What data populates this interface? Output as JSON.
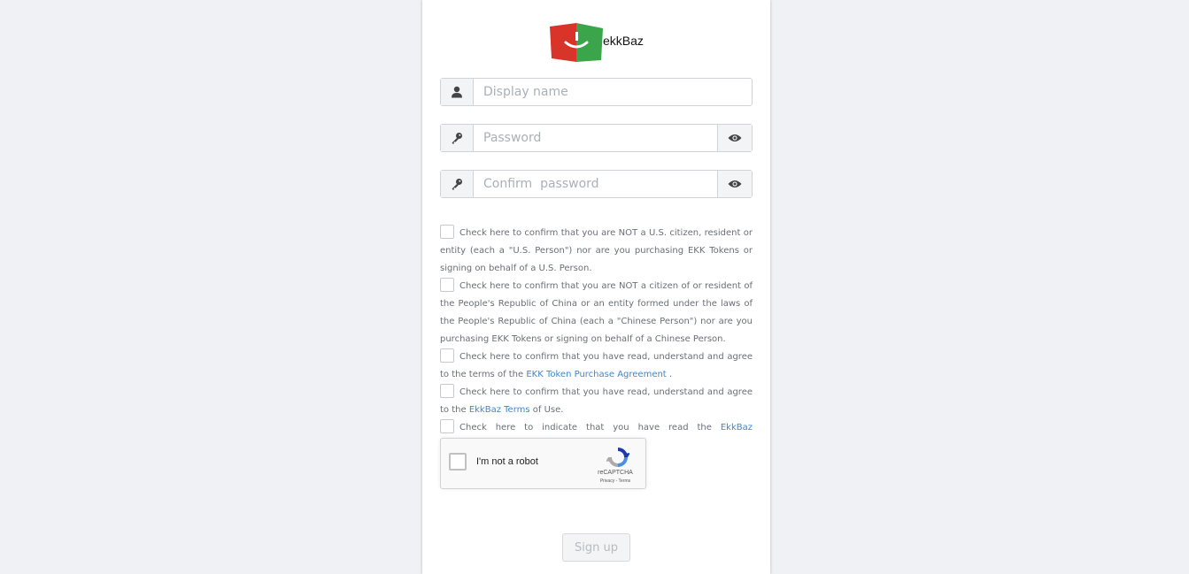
{
  "brand": {
    "name": "ekkBaz",
    "colors": {
      "red": "#d8342a",
      "green": "#3aa54a"
    }
  },
  "form": {
    "display_name": {
      "placeholder": "Display name",
      "value": "",
      "icon": "user-icon"
    },
    "password": {
      "placeholder": "Password",
      "value": "",
      "icon": "key-icon",
      "toggle_icon": "eye-icon"
    },
    "confirm_password": {
      "placeholder": "Confirm  password",
      "value": "",
      "icon": "key-icon",
      "toggle_icon": "eye-icon"
    }
  },
  "checks": [
    {
      "text": "Check here to confirm that you are NOT a U.S. citizen, resident or entity (each a \"U.S. Person\") nor are you purchasing EKK Tokens or signing on behalf of a U.S. Person.",
      "checked": false
    },
    {
      "text": "Check here to confirm that you are NOT a citizen of or resident of the People's Republic of China or an entity formed under the laws of the People's Republic of China (each a \"Chinese Person\") nor are you purchasing EKK Tokens or signing on behalf of a Chinese Person.",
      "checked": false
    },
    {
      "prefix": "Check here to confirm that you have read, understand and agree to the terms of the ",
      "link": "EKK Token Purchase Agreement",
      "suffix": " .",
      "checked": false
    },
    {
      "prefix": "Check here to confirm that you have read, understand and agree to the ",
      "link": "EkkBaz Terms",
      "suffix": " of Use.",
      "checked": false
    },
    {
      "prefix": "Check here to indicate that you have read the ",
      "link": "EkkBaz Whitepaper",
      "suffix": ".",
      "checked": false
    }
  ],
  "recaptcha": {
    "label": "I'm not a robot",
    "brand": "reCAPTCHA",
    "terms": "Privacy - Terms"
  },
  "submit": {
    "label": "Sign up",
    "disabled": true
  }
}
